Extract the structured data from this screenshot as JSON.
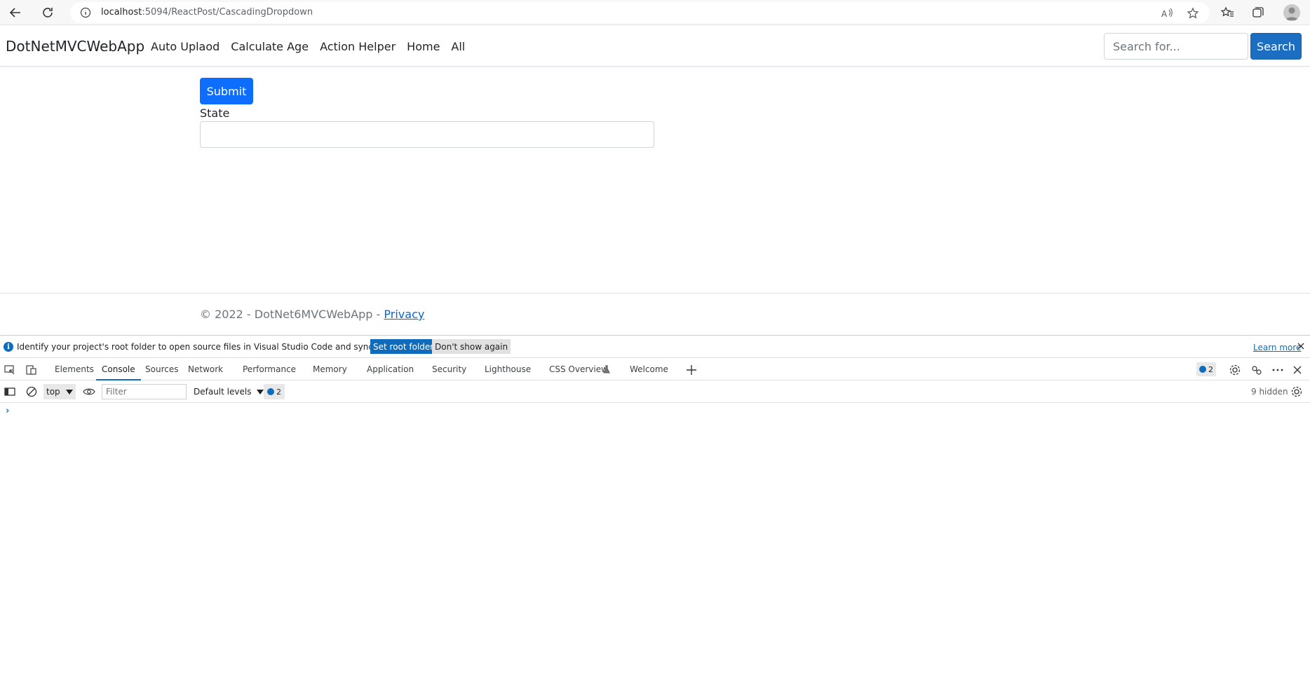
{
  "browser": {
    "url_host": "localhost",
    "url_path": ":5094/ReactPost/CascadingDropdown"
  },
  "navbar": {
    "brand": "DotNetMVCWebApp",
    "links": [
      "Auto Uplaod",
      "Calculate Age",
      "Action Helper",
      "Home",
      "All"
    ],
    "search_placeholder": "Search for...",
    "search_button": "Search"
  },
  "form": {
    "submit_label": "Submit",
    "state_label": "State",
    "state_value": ""
  },
  "footer": {
    "copyright": "© 2022 - DotNet6MVCWebApp - ",
    "privacy_link": "Privacy"
  },
  "devtools": {
    "info_message": "Identify your project's root folder to open source files in Visual Studio Code and sync changes.",
    "set_root_button": "Set root folder",
    "dont_show_button": "Don't show again",
    "learn_more": "Learn more",
    "tabs": [
      "Elements",
      "Console",
      "Sources",
      "Network",
      "Performance",
      "Memory",
      "Application",
      "Security",
      "Lighthouse",
      "CSS Overview",
      "Welcome"
    ],
    "active_tab": "Console",
    "issues_count": "2",
    "context": "top",
    "filter_placeholder": "Filter",
    "levels": "Default levels",
    "console_issues_count": "2",
    "hidden_count": "9 hidden"
  }
}
